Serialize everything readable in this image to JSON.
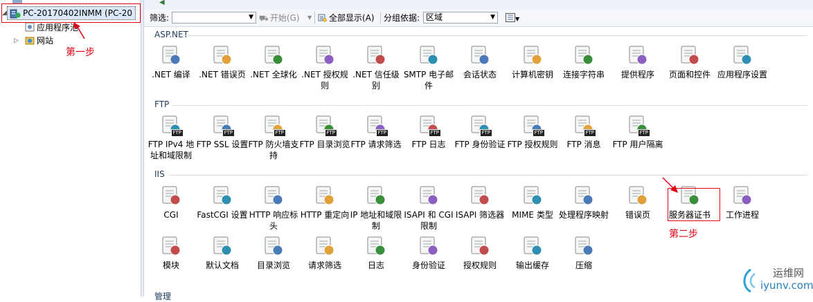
{
  "tree": {
    "server": "PC-20170402INMM (PC-20",
    "items": [
      "应用程序池",
      "网站"
    ]
  },
  "annotations": {
    "step1": "第一步",
    "step2": "第二步",
    "color": "#e60012"
  },
  "toolbar": {
    "filter_label": "筛选:",
    "filter_value": "",
    "start_label": "开始(G)",
    "show_all_label": "全部显示(A)",
    "groupby_label": "分组依据:",
    "groupby_value": "区域"
  },
  "groups": [
    {
      "title": "ASP.NET",
      "items": [
        ".NET 编译",
        ".NET 错误页",
        ".NET 全球化",
        ".NET 授权规则",
        ".NET 信任级别",
        "SMTP 电子邮件",
        "会话状态",
        "计算机密钥",
        "连接字符串",
        "提供程序",
        "页面和控件",
        "应用程序设置"
      ]
    },
    {
      "title": "FTP",
      "items": [
        "FTP IPv4 地址和域限制",
        "FTP SSL 设置",
        "FTP 防火墙支持",
        "FTP 目录浏览",
        "FTP 请求筛选",
        "FTP 日志",
        "FTP 身份验证",
        "FTP 授权规则",
        "FTP 消息",
        "FTP 用户隔离"
      ]
    },
    {
      "title": "IIS",
      "items": [
        "CGI",
        "FastCGI 设置",
        "HTTP 响应标头",
        "HTTP 重定向",
        "IP 地址和域限制",
        "ISAPI 和 CGI 限制",
        "ISAPI 筛选器",
        "MIME 类型",
        "处理程序映射",
        "错误页",
        "服务器证书",
        "工作进程",
        "模块",
        "默认文档",
        "目录浏览",
        "请求筛选",
        "日志",
        "身份验证",
        "授权规则",
        "输出缓存",
        "压缩"
      ]
    },
    {
      "title": "管理"
    }
  ],
  "watermark": {
    "name": "运维网",
    "url": "iyunv.com"
  }
}
